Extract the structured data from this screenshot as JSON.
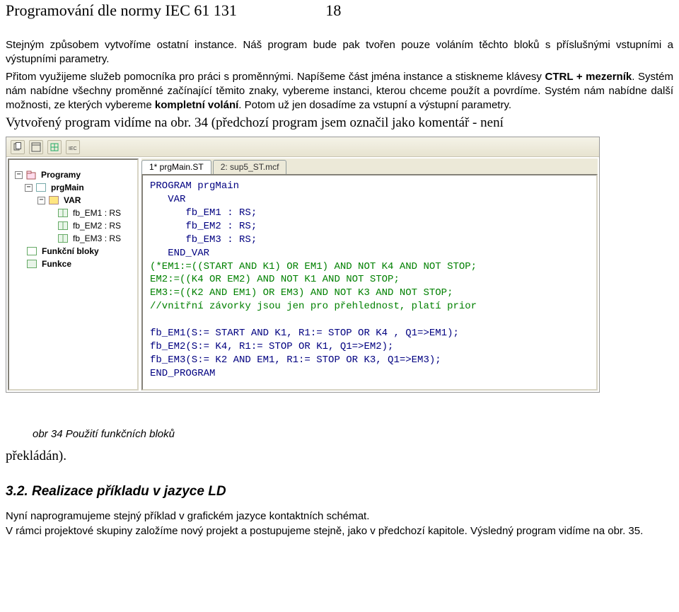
{
  "header": {
    "title": "Programování dle normy IEC 61 131",
    "pagenum": "18"
  },
  "para1_a": "Stejným způsobem vytvoříme ostatní instance. Náš program bude pak tvořen pouze voláním těchto bloků s příslušnými vstupními a výstupními parametry.",
  "para1_b": "Přitom využijeme služeb pomocníka pro práci s proměnnými. Napíšeme část jména instance a stiskneme klávesy ",
  "para1_b_bold": "CTRL + mezerník",
  "para1_b2": ". Systém nám nabídne všechny proměnné začínající těmito znaky, vybereme instanci, kterou chceme použít a povrdíme. Systém nám nabídne další možnosti, ze kterých vybereme ",
  "para1_b_bold2": "kompletní volání",
  "para1_b3": ". Potom už jen dosadíme za vstupní a výstupní parametry.",
  "serif_line": "Vytvořený program vidíme na obr. 34 (předchozí program jsem označil jako komentář - není",
  "tree": {
    "programs": "Programy",
    "prgMain": "prgMain",
    "var": "VAR",
    "fb_em1": "fb_EM1 : RS",
    "fb_em2": "fb_EM2 : RS",
    "fb_em3": "fb_EM3 : RS",
    "fblocks": "Funkční bloky",
    "func": "Funkce"
  },
  "tabs": {
    "tab1": "1* prgMain.ST",
    "tab2": "2: sup5_ST.mcf"
  },
  "code": {
    "l1": "PROGRAM prgMain",
    "l2": "   VAR",
    "l3": "      fb_EM1 : RS;",
    "l4": "      fb_EM2 : RS;",
    "l5": "      fb_EM3 : RS;",
    "l6": "   END_VAR",
    "g1": "(*EM1:=((START AND K1) OR EM1) AND NOT K4 AND NOT STOP;",
    "g2": "EM2:=((K4 OR EM2) AND NOT K1 AND NOT STOP;",
    "g3": "EM3:=((K2 AND EM1) OR EM3) AND NOT K3 AND NOT STOP;",
    "g4": "//vnitřní závorky jsou jen pro přehlednost, platí prior",
    "blank": "",
    "l7": "fb_EM1(S:= START AND K1, R1:= STOP OR K4 , Q1=>EM1);",
    "l8": "fb_EM2(S:= K4, R1:= STOP OR K1, Q1=>EM2);",
    "l9": "fb_EM3(S:= K2 AND EM1, R1:= STOP OR K3, Q1=>EM3);",
    "l10": "END_PROGRAM"
  },
  "caption": "obr 34 Použití funkčních bloků",
  "after_caption": "překládán).",
  "section_h": "3.2. Realizace příkladu v jazyce LD",
  "para_final1": "Nyní naprogramujeme stejný příklad v grafickém jazyce kontaktních schémat.",
  "para_final2": "V rámci projektové skupiny založíme nový projekt a postupujeme stejně, jako v předchozí kapitole. Výsledný program vidíme na obr. 35."
}
